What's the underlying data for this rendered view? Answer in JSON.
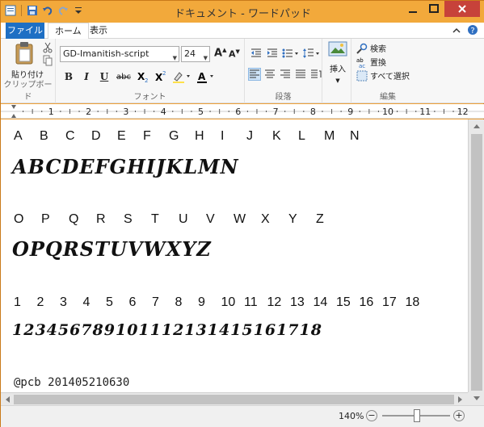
{
  "window": {
    "title": "ドキュメント - ワードパッド"
  },
  "tabs": {
    "file": "ファイル",
    "home": "ホーム",
    "view": "表示"
  },
  "ribbon": {
    "clipboard": {
      "paste": "貼り付け",
      "group": "クリップボード"
    },
    "font": {
      "name": "GD-Imanitish-script",
      "size": "24",
      "group": "フォント",
      "bold": "B",
      "italic": "I",
      "underline": "U",
      "strike": "abc"
    },
    "paragraph": {
      "group": "段落"
    },
    "insert": {
      "label": "挿入"
    },
    "editing": {
      "find": "検索",
      "replace": "置換",
      "select_all": "すべて選択",
      "group": "編集"
    }
  },
  "ruler": {
    "marks": [
      "1",
      "2",
      "3",
      "4",
      "5",
      "6",
      "7",
      "8",
      "9",
      "10",
      "11",
      "12"
    ]
  },
  "document": {
    "row1_labels": [
      "A",
      "B",
      "C",
      "D",
      "E",
      "F",
      "G",
      "H",
      "I",
      "J",
      "K",
      "L",
      "M",
      "N"
    ],
    "row1_glyphs": "ABCDEFGHIJKLMN",
    "row2_labels": [
      "O",
      "P",
      "Q",
      "R",
      "S",
      "T",
      "U",
      "V",
      "W",
      "X",
      "Y",
      "Z"
    ],
    "row2_glyphs": "OPQRSTUVWXYZ",
    "row3_labels": [
      "1",
      "2",
      "3",
      "4",
      "5",
      "6",
      "7",
      "8",
      "9",
      "10",
      "11",
      "12",
      "13",
      "14",
      "15",
      "16",
      "17",
      "18"
    ],
    "row3_glyphs": "123456789101112131415161718",
    "stamp": "@pcb 201405210630"
  },
  "status": {
    "zoom": "140%",
    "zoom_value_percent": 140
  }
}
